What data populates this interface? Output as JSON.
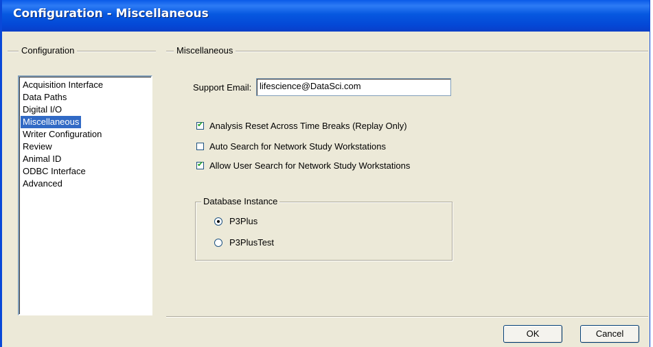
{
  "window": {
    "title": "Configuration - Miscellaneous"
  },
  "left_panel": {
    "group_label": "Configuration",
    "items": [
      {
        "label": "Acquisition Interface",
        "selected": false
      },
      {
        "label": "Data Paths",
        "selected": false
      },
      {
        "label": "Digital I/O",
        "selected": false
      },
      {
        "label": "Miscellaneous",
        "selected": true
      },
      {
        "label": "Writer Configuration",
        "selected": false
      },
      {
        "label": "Review",
        "selected": false
      },
      {
        "label": "Animal ID",
        "selected": false
      },
      {
        "label": "ODBC Interface",
        "selected": false
      },
      {
        "label": "Advanced",
        "selected": false
      }
    ]
  },
  "misc": {
    "group_label": "Miscellaneous",
    "support_email_label": "Support Email:",
    "support_email_value": "lifescience@DataSci.com",
    "checkboxes": [
      {
        "label": "Analysis Reset Across Time Breaks (Replay Only)",
        "checked": true
      },
      {
        "label": "Auto Search for Network Study Workstations",
        "checked": false
      },
      {
        "label": "Allow User Search for Network Study Workstations",
        "checked": true
      }
    ],
    "database_instance": {
      "label": "Database Instance",
      "options": [
        {
          "label": "P3Plus",
          "selected": true
        },
        {
          "label": "P3PlusTest",
          "selected": false
        }
      ]
    }
  },
  "buttons": {
    "ok": "OK",
    "cancel": "Cancel"
  }
}
